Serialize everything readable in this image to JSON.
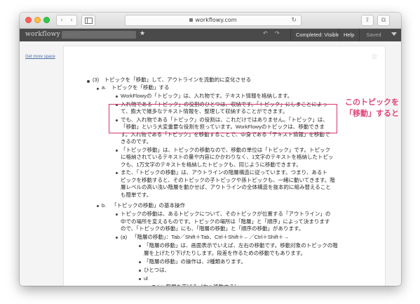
{
  "browser": {
    "url": "workflowy.com"
  },
  "app": {
    "logo": "workflowy",
    "search_placeholder": "Search",
    "completed_label": "Completed: Visible",
    "help_label": "Help",
    "saved_label": "Saved"
  },
  "sidebar": {
    "get_more_space": "Get more space"
  },
  "outline": {
    "root": "(3)　トピックを「移動」して、アウトラインを流動的に変化させる",
    "a_label": "a.",
    "a_text": "トピックを「移動」する",
    "a_items": [
      [
        "WorkFlowyの「トピック」は、入れ物です。テキスト情報を格納します。"
      ],
      [
        "入れ物である「トピック」の役割のひとつは、収納です。「トピック」にしまことによっ",
        "て、膨大で雑多なテキスト情報を、整理して収納することができます。"
      ],
      [
        "でも、入れ物である「トピック」の役割は、これだけではありません。「トピック」は、",
        "「移動」という大変重要な役割を担っています。WorkFlowyのトピックは、移動できま",
        "す。入れ物である「トピック」を移動することで、中身である「テキスト情報」を移動で",
        "きるのです。"
      ],
      [
        "「トピック移動」は、トピックの移動なので、移動の単位は「トピック」です。トピック",
        "に格納されているテキストの量や内容にかかわりなく、1文字のテキストを格納したトピッ",
        "クも、1万文字のテキストを格納したトピックも、同じように移動できます。"
      ],
      [
        "また、「トピックの移動」は、アウトラインの階層構造に従っています。つまり、あるト",
        "ピックを移動すると、そのトピックの子トピックや孫トピックも、一緒に動いてきます。階",
        "層レベルの高い浅い階層を動かせば、アウトラインの全体構造を抜本的に組み替えること",
        "も簡単です。"
      ]
    ],
    "b_label": "b.",
    "b_text": "「トピックの移動」の基本操作",
    "b_item": [
      "トピックの移動は、あるトピックについて、そのトピックが位置する「アウトライン」の",
      "中での場所を変えるものです。トピックの場所は「階層」と「順序」によって決まります",
      "ので、「トピックの移動」にも、「階層の移動」と「順序の移動」があります。"
    ],
    "a2_label": "(a)",
    "a2_text": "「階層の移動」：Tab／Shift＋Tab、Ctrl＋Shift＋←／Ctrl＋Shift＋→",
    "a2_items": [
      [
        "「階層の移動」は、画面表示でいえば、左右の移動です。移動対象のトピックの階",
        "層を上げたり下げたりします。段差を作るための移動でもあります。"
      ],
      [
        "「階層の移動」の操作は、2種類あります。"
      ],
      [
        "ひとつは、"
      ],
      [
        "ul"
      ]
    ],
    "tab_item": "Tab：階層を下げる（右へ移動する）"
  },
  "annotation": {
    "callout_line1": "このトピックを",
    "callout_line2": "「移動」すると"
  },
  "colors": {
    "accent": "#e0447b",
    "appbar": "#4a4a4a"
  }
}
